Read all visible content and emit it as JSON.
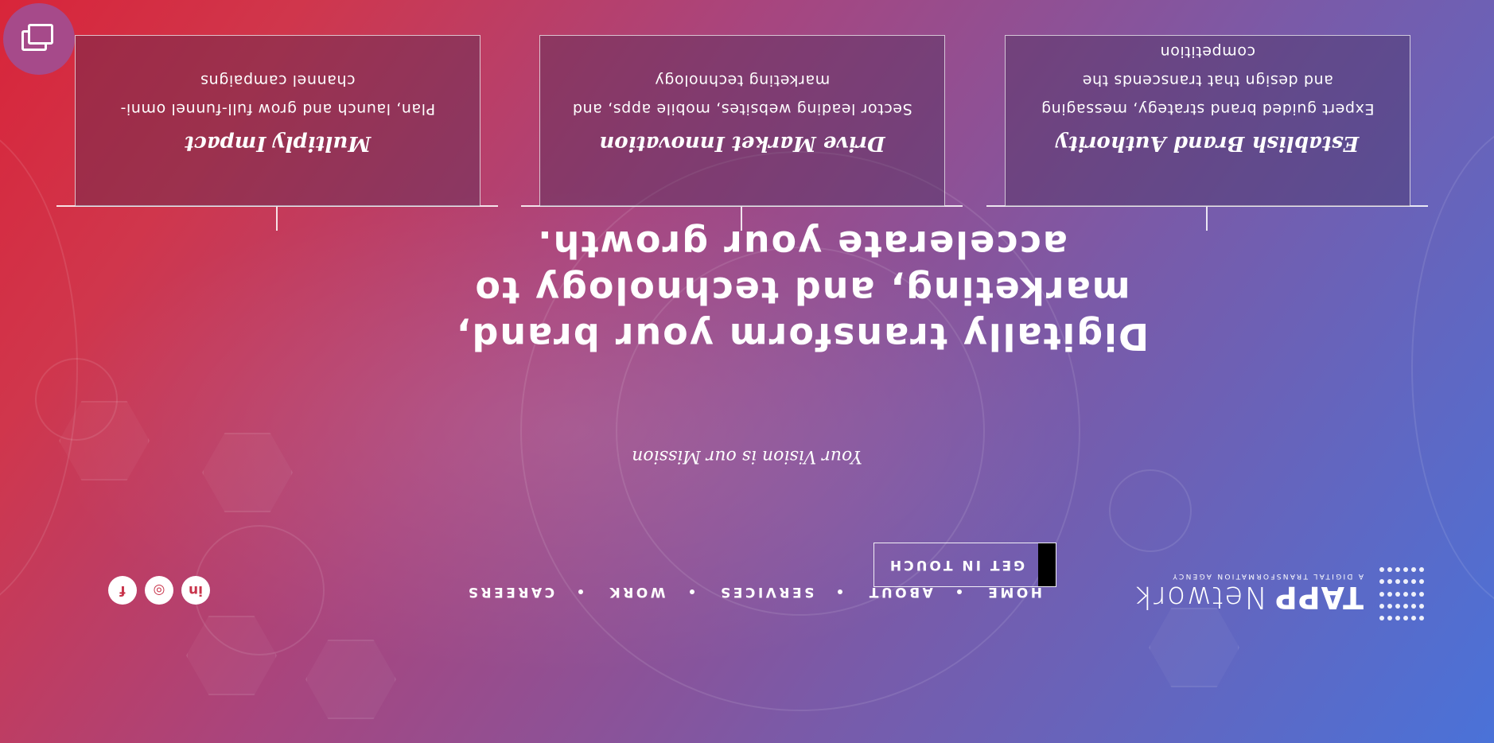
{
  "brand": {
    "bold": "TAPP",
    "light": "Network",
    "tagline": "A DIGITAL TRANSFORMATION AGENCY"
  },
  "nav": {
    "items": [
      "HOME",
      "ABOUT",
      "SERVICES",
      "WORK",
      "CAREERS"
    ]
  },
  "cta": {
    "label": "GET IN TOUCH"
  },
  "socials": [
    {
      "icon": "linkedin-icon",
      "glyph": "in"
    },
    {
      "icon": "instagram-icon",
      "glyph": "◎"
    },
    {
      "icon": "facebook-icon",
      "glyph": "f"
    }
  ],
  "hero": {
    "tagline": "Your Vision is our Mission",
    "headline": "Digitally transform your brand, marketing, and technology to accelerate your growth."
  },
  "cards": [
    {
      "title": "Establish Brand Authority",
      "desc": "Expert guided brand strategy, messaging and design that transcends the competition"
    },
    {
      "title": "Drive Market Innovation",
      "desc": "Sector leading websites, mobile apps, and marketing technology"
    },
    {
      "title": "Multiply Impact",
      "desc": "Plan, launch and grow full-funnel omni-channel campaigns"
    }
  ],
  "chat": {
    "icon": "chat-windows-icon"
  },
  "colors": {
    "gradient_start": "#4a72d8",
    "gradient_mid": "#a8457e",
    "gradient_end": "#d8253a",
    "cta_bar": "#000000"
  }
}
